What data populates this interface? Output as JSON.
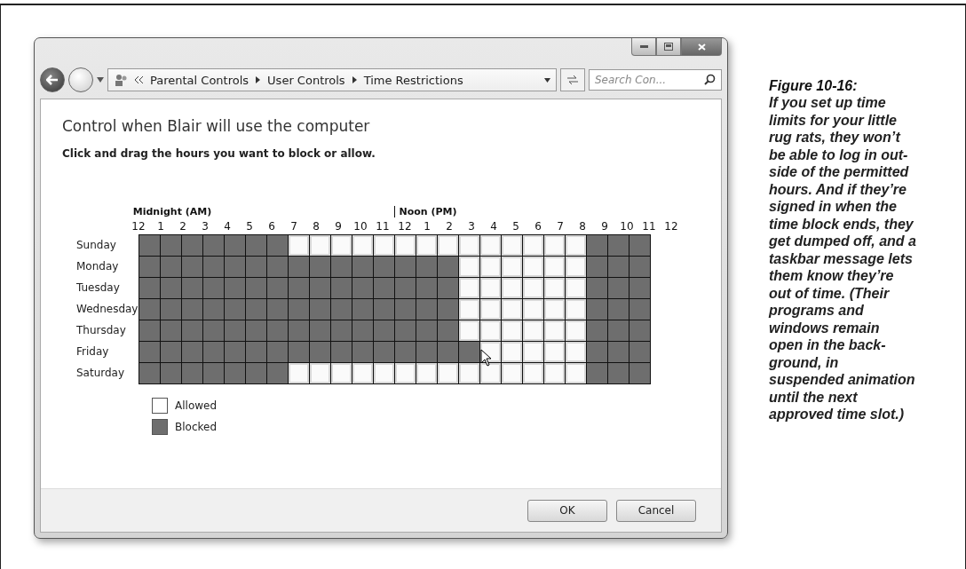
{
  "window": {
    "breadcrumb": [
      "Parental Controls",
      "User Controls",
      "Time Restrictions"
    ],
    "search": {
      "placeholder": "Search Con..."
    }
  },
  "heading": "Control when Blair will use the computer",
  "instruction": "Click and drag the hours you want to block or allow.",
  "schedule": {
    "am_label": "Midnight (AM)",
    "pm_label": "Noon (PM)",
    "hours": [
      "12",
      "1",
      "2",
      "3",
      "4",
      "5",
      "6",
      "7",
      "8",
      "9",
      "10",
      "11",
      "12",
      "1",
      "2",
      "3",
      "4",
      "5",
      "6",
      "7",
      "8",
      "9",
      "10",
      "11",
      "12"
    ],
    "days": [
      {
        "name": "Sunday",
        "blocked": [
          true,
          true,
          true,
          true,
          true,
          true,
          true,
          false,
          false,
          false,
          false,
          false,
          false,
          false,
          false,
          false,
          false,
          false,
          false,
          false,
          false,
          true,
          true,
          true
        ]
      },
      {
        "name": "Monday",
        "blocked": [
          true,
          true,
          true,
          true,
          true,
          true,
          true,
          true,
          true,
          true,
          true,
          true,
          true,
          true,
          true,
          false,
          false,
          false,
          false,
          false,
          false,
          true,
          true,
          true
        ]
      },
      {
        "name": "Tuesday",
        "blocked": [
          true,
          true,
          true,
          true,
          true,
          true,
          true,
          true,
          true,
          true,
          true,
          true,
          true,
          true,
          true,
          false,
          false,
          false,
          false,
          false,
          false,
          true,
          true,
          true
        ]
      },
      {
        "name": "Wednesday",
        "blocked": [
          true,
          true,
          true,
          true,
          true,
          true,
          true,
          true,
          true,
          true,
          true,
          true,
          true,
          true,
          true,
          false,
          false,
          false,
          false,
          false,
          false,
          true,
          true,
          true
        ]
      },
      {
        "name": "Thursday",
        "blocked": [
          true,
          true,
          true,
          true,
          true,
          true,
          true,
          true,
          true,
          true,
          true,
          true,
          true,
          true,
          true,
          false,
          false,
          false,
          false,
          false,
          false,
          true,
          true,
          true
        ]
      },
      {
        "name": "Friday",
        "blocked": [
          true,
          true,
          true,
          true,
          true,
          true,
          true,
          true,
          true,
          true,
          true,
          true,
          true,
          true,
          true,
          true,
          false,
          false,
          false,
          false,
          false,
          true,
          true,
          true
        ]
      },
      {
        "name": "Saturday",
        "blocked": [
          true,
          true,
          true,
          true,
          true,
          true,
          true,
          false,
          false,
          false,
          false,
          false,
          false,
          false,
          false,
          false,
          false,
          false,
          false,
          false,
          false,
          true,
          true,
          true
        ]
      }
    ],
    "legend": [
      {
        "label": "Allowed",
        "blocked": false
      },
      {
        "label": "Blocked",
        "blocked": true
      }
    ]
  },
  "buttons": [
    "OK",
    "Cancel"
  ],
  "caption": {
    "title": "Figure 10-16:",
    "text": "If you set up time limits for your little rug rats, they won’t be able to log in out-side of the permitted hours. And if they’re signed in when the time block ends, they get dumped off, and a taskbar message lets them know they’re out of time. (Their programs and windows remain open in the back-ground, in suspended animation until the next approved time slot.)"
  }
}
